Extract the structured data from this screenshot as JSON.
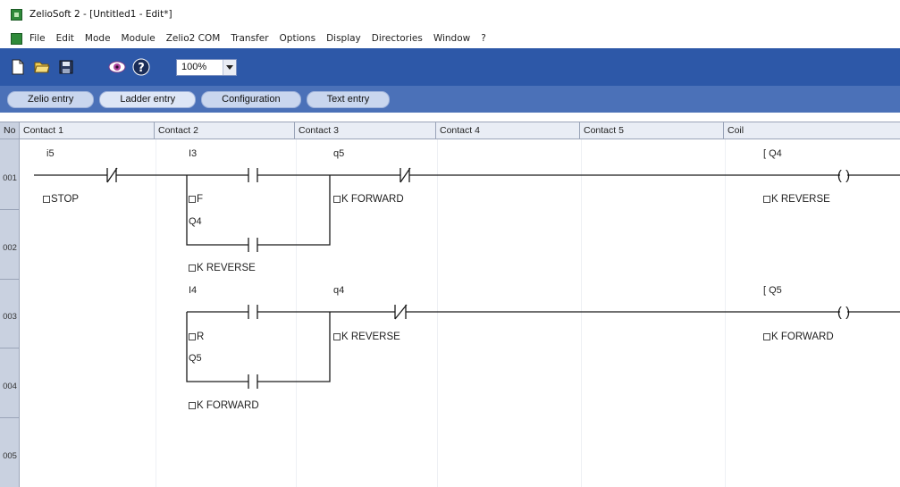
{
  "window": {
    "title": "ZelioSoft 2 - [Untitled1 - Edit*]"
  },
  "menu": {
    "items": [
      "File",
      "Edit",
      "Mode",
      "Module",
      "Zelio2 COM",
      "Transfer",
      "Options",
      "Display",
      "Directories",
      "Window",
      "?"
    ]
  },
  "toolbar": {
    "zoom_value": "100%",
    "icons": [
      "new-document-icon",
      "open-folder-icon",
      "save-disk-icon",
      "view-eye-icon",
      "help-icon"
    ]
  },
  "tabs": {
    "zelio_entry": "Zelio entry",
    "ladder_entry": "Ladder entry",
    "configuration": "Configuration",
    "text_entry": "Text entry"
  },
  "grid": {
    "headers": {
      "no": "No",
      "contact1": "Contact 1",
      "contact2": "Contact 2",
      "contact3": "Contact 3",
      "contact4": "Contact 4",
      "contact5": "Contact 5",
      "coil": "Coil"
    },
    "rows": [
      "001",
      "002",
      "003",
      "004",
      "005"
    ]
  },
  "ladder": {
    "rung1": {
      "c1_addr": "i5",
      "c1_comment": "STOP",
      "c2_addr": "I3",
      "c2_comment": "F",
      "c3_addr": "q5",
      "c3_comment": "K FORWARD",
      "coil_addr": "[ Q4",
      "coil_comment": "K REVERSE",
      "branch_addr": "Q4",
      "branch_comment": "K REVERSE"
    },
    "rung2": {
      "c2_addr": "I4",
      "c2_comment": "R",
      "c3_addr": "q4",
      "c3_comment": "K REVERSE",
      "coil_addr": "[ Q5",
      "coil_comment": "K FORWARD",
      "branch_addr": "Q5",
      "branch_comment": "K FORWARD"
    },
    "coil_symbol": "( )"
  },
  "colors": {
    "toolbar_bg": "#2d58a8",
    "tabstrip_bg": "#4b71b8",
    "header_bg": "#e9edf5",
    "line": "#1a1a1a"
  }
}
